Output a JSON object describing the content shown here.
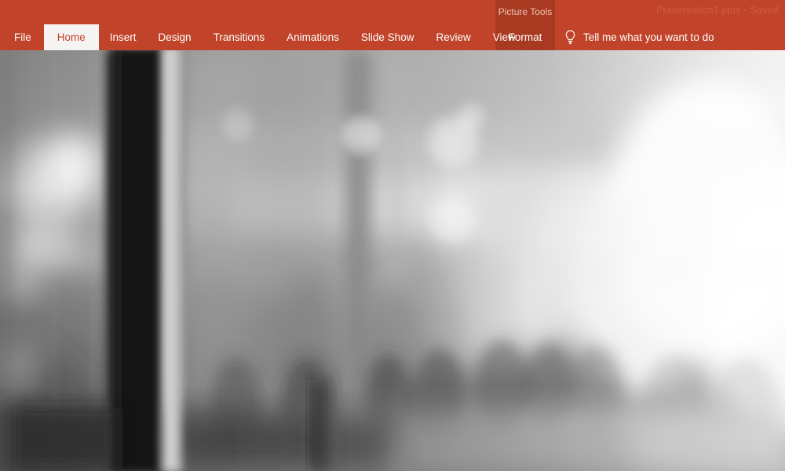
{
  "window": {
    "document_title": "Präsentation1.pptx  -  Saved",
    "app_accent_color": "#c1442a",
    "contextual_tab_color": "#a93a22",
    "active_tab_bg": "#f6f4f3"
  },
  "ribbon": {
    "contextual": {
      "group_title": "Picture Tools",
      "tab_label": "Format"
    },
    "tabs": [
      {
        "label": "File",
        "active": false
      },
      {
        "label": "Home",
        "active": true
      },
      {
        "label": "Insert",
        "active": false
      },
      {
        "label": "Design",
        "active": false
      },
      {
        "label": "Transitions",
        "active": false
      },
      {
        "label": "Animations",
        "active": false
      },
      {
        "label": "Slide Show",
        "active": false
      },
      {
        "label": "Review",
        "active": false
      },
      {
        "label": "View",
        "active": false
      }
    ],
    "tell_me": {
      "icon": "lightbulb-icon",
      "label": "Tell me what you want to do"
    }
  },
  "slide": {
    "content_type": "photograph",
    "description": "Blurred black-and-white photograph of a crowd of people in a large hall seen through a glass doorway, with out-of-focus bokeh ceiling lights and a dark vertical door frame on the left.",
    "palette": {
      "darkest": "#0d0d0d",
      "dark": "#4a4a4a",
      "mid": "#8d8d8d",
      "light": "#d2d2d2",
      "lightest": "#fdfdfd"
    }
  }
}
